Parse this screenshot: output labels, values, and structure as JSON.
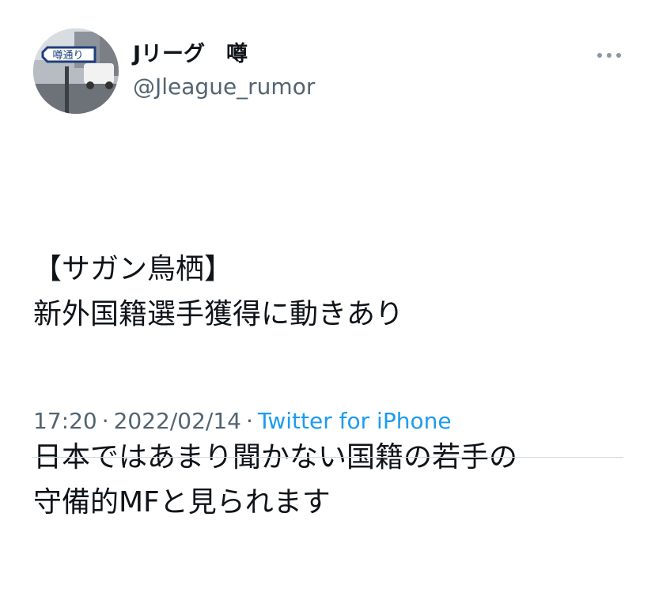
{
  "user": {
    "display_name": "Jリーグ　噂",
    "handle": "@Jleague_rumor",
    "avatar_sign_text": "噂通り"
  },
  "tweet": {
    "lines": [
      "【サガン鳥栖】\n新外国籍選手獲得に動きあり",
      "日本ではあまり聞かない国籍の若手の\n守備的MFと見られます"
    ],
    "time": "17:20",
    "date": "2022/02/14",
    "separator": "·",
    "source": "Twitter for iPhone"
  },
  "icons": {
    "more": "more-horizontal-icon"
  },
  "colors": {
    "text": "#0f1419",
    "secondary": "#536471",
    "link": "#1d9bf0",
    "divider": "#cfd9de"
  }
}
